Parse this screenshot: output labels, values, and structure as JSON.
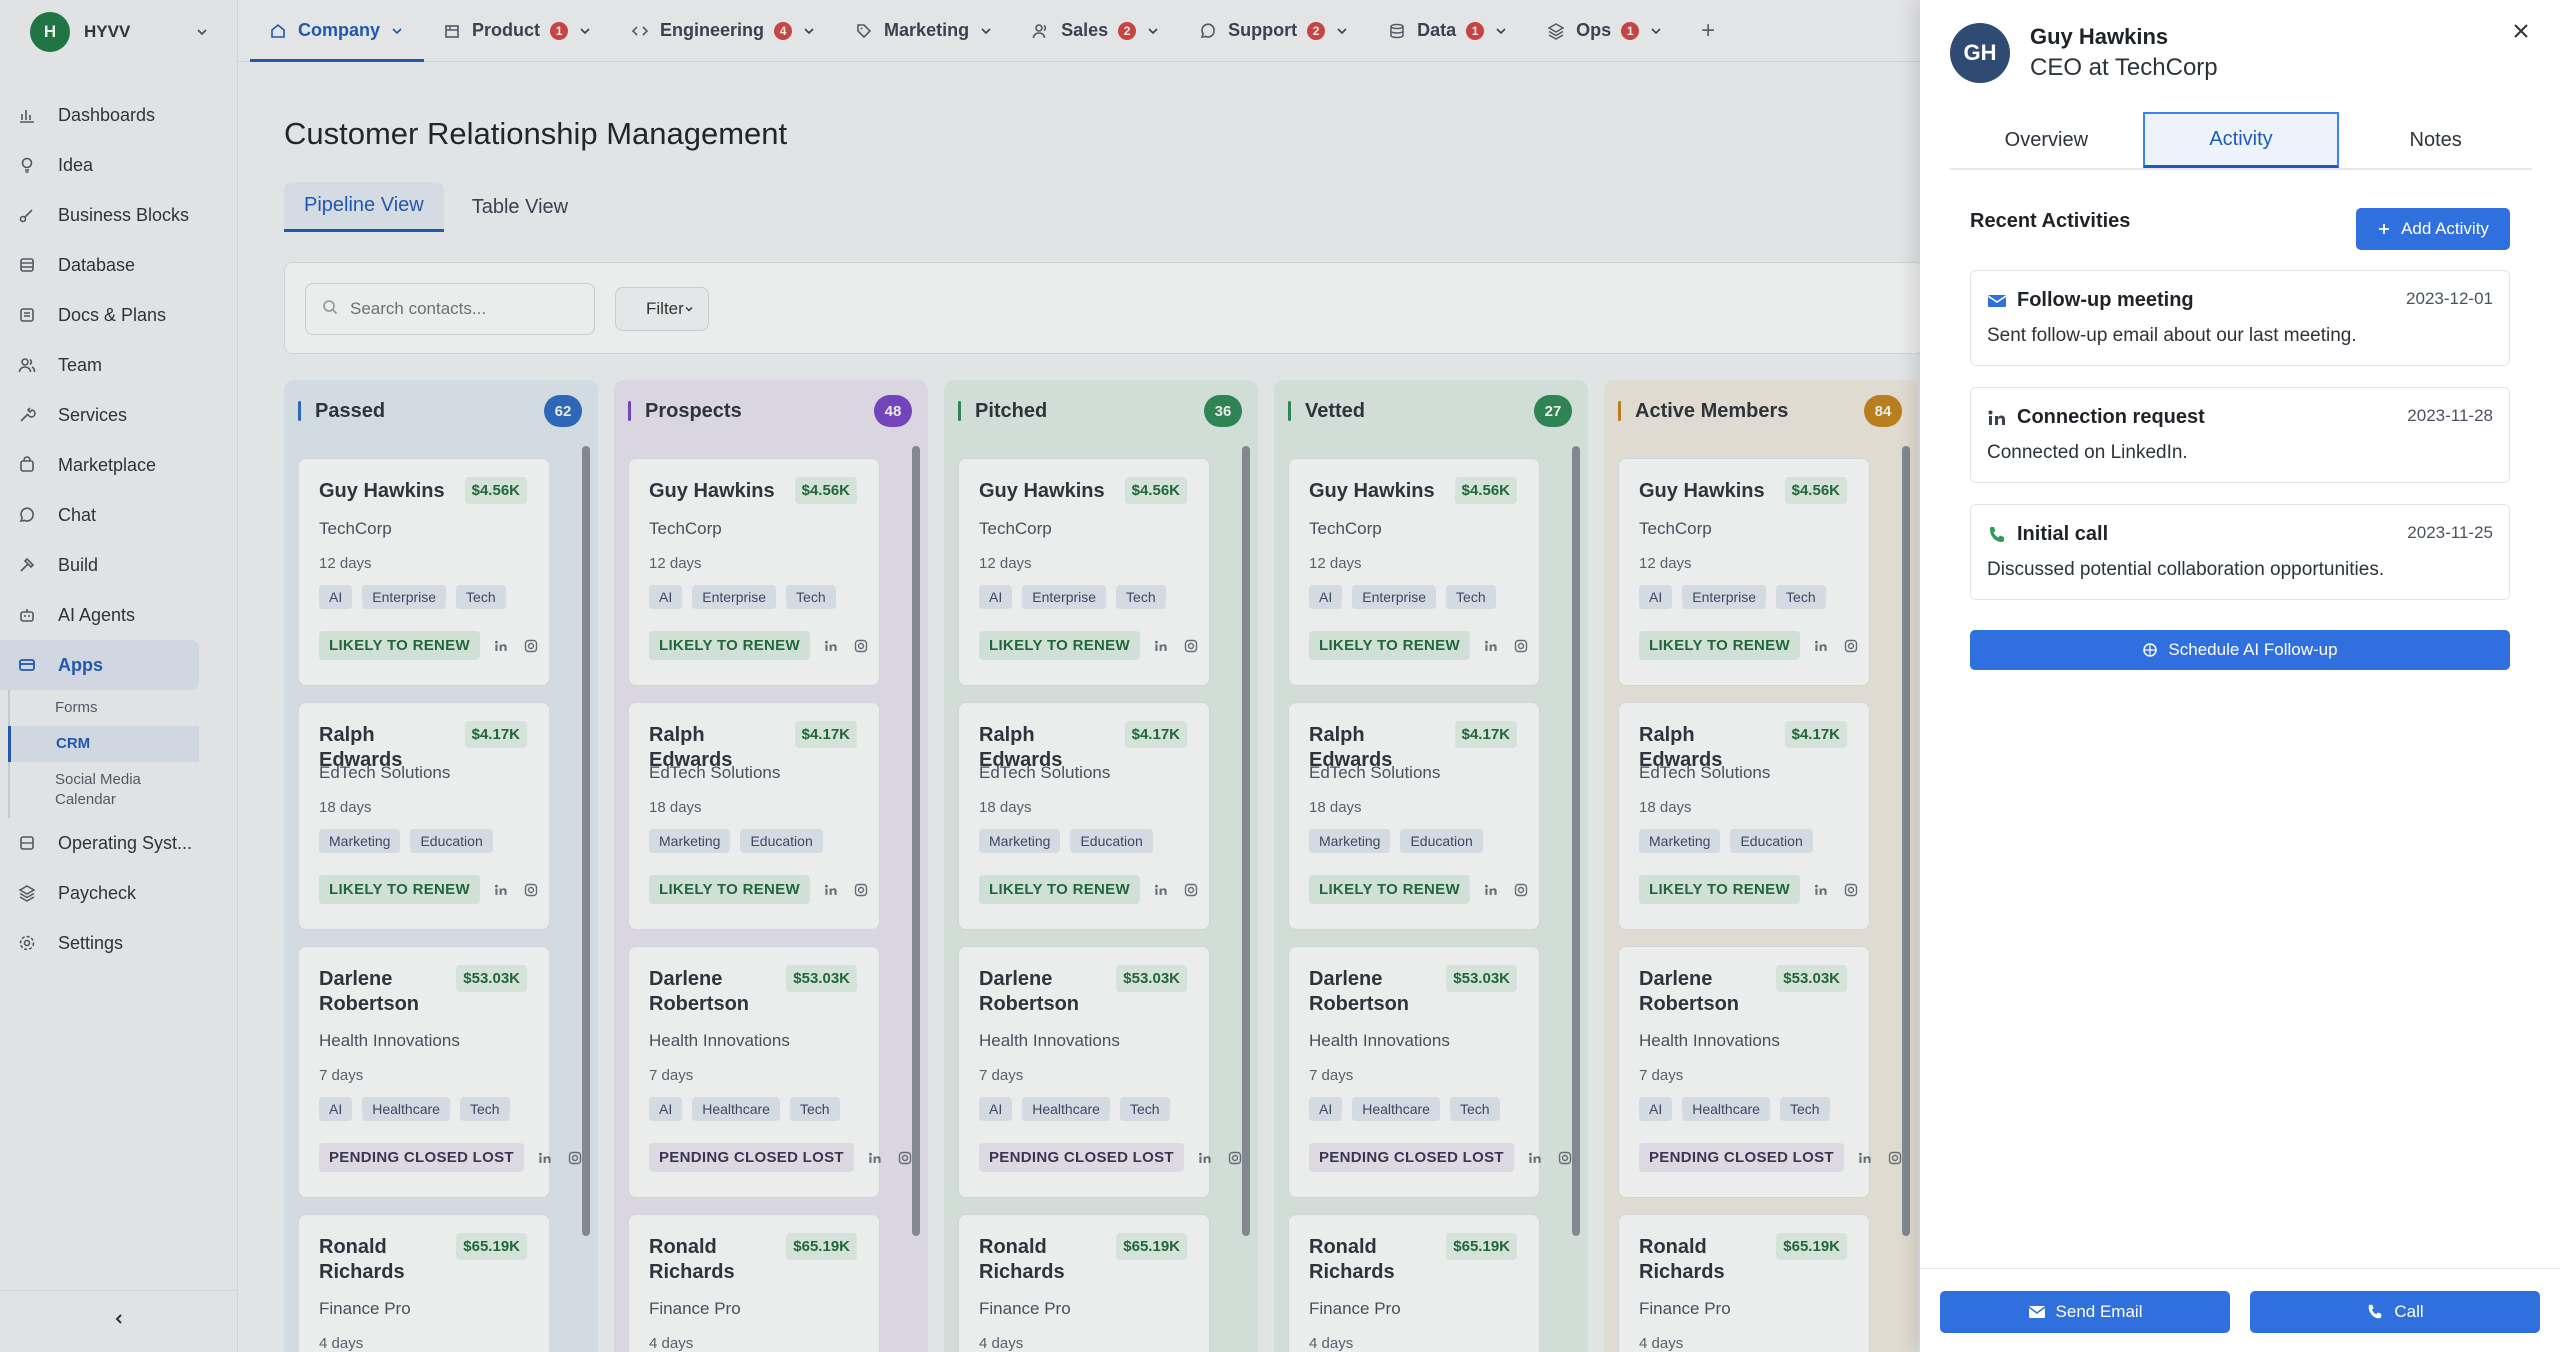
{
  "workspace": {
    "initial": "H",
    "name": "HYVV"
  },
  "sidebar": {
    "items": [
      {
        "label": "Dashboards",
        "icon": "bar-chart-icon"
      },
      {
        "label": "Idea",
        "icon": "lightbulb-icon"
      },
      {
        "label": "Business Blocks",
        "icon": "blocks-icon"
      },
      {
        "label": "Database",
        "icon": "database-icon"
      },
      {
        "label": "Docs & Plans",
        "icon": "docs-icon"
      },
      {
        "label": "Team",
        "icon": "team-icon"
      },
      {
        "label": "Services",
        "icon": "wrench-icon"
      },
      {
        "label": "Marketplace",
        "icon": "store-icon"
      },
      {
        "label": "Chat",
        "icon": "chat-icon"
      },
      {
        "label": "Build",
        "icon": "hammer-icon"
      },
      {
        "label": "AI Agents",
        "icon": "robot-icon"
      },
      {
        "label": "Apps",
        "icon": "apps-icon"
      }
    ],
    "sub_items": [
      {
        "label": "Forms"
      },
      {
        "label": "CRM"
      },
      {
        "label": "Social Media Calendar"
      }
    ],
    "bottom_items": [
      {
        "label": "Operating Syst...",
        "icon": "layers-icon"
      },
      {
        "label": "Paycheck",
        "icon": "layers-icon"
      },
      {
        "label": "Settings",
        "icon": "gear-icon"
      }
    ]
  },
  "topbar": {
    "tabs": [
      {
        "label": "Company",
        "badge": null,
        "icon": "home-icon"
      },
      {
        "label": "Product",
        "badge": "1",
        "icon": "box-icon"
      },
      {
        "label": "Engineering",
        "badge": "4",
        "icon": "code-icon"
      },
      {
        "label": "Marketing",
        "badge": null,
        "icon": "tag-icon"
      },
      {
        "label": "Sales",
        "badge": "2",
        "icon": "people-icon"
      },
      {
        "label": "Support",
        "badge": "2",
        "icon": "chat-icon"
      },
      {
        "label": "Data",
        "badge": "1",
        "icon": "database-icon"
      },
      {
        "label": "Ops",
        "badge": "1",
        "icon": "stack-icon"
      }
    ],
    "add_label": "+"
  },
  "main": {
    "title": "Customer Relationship Management",
    "view_tabs": [
      {
        "label": "Pipeline View"
      },
      {
        "label": "Table View"
      }
    ],
    "search_placeholder": "Search contacts...",
    "filter_label": "Filter"
  },
  "board": {
    "columns": [
      {
        "name": "Passed",
        "count": "62",
        "color": "#2d6bc4",
        "bg": "#e4ebf4"
      },
      {
        "name": "Prospects",
        "count": "48",
        "color": "#7b45c9",
        "bg": "#ebe6f3"
      },
      {
        "name": "Pitched",
        "count": "36",
        "color": "#2e8b57",
        "bg": "#e3efe8"
      },
      {
        "name": "Vetted",
        "count": "27",
        "color": "#2e8b57",
        "bg": "#e3efe8"
      },
      {
        "name": "Active Members",
        "count": "84",
        "color": "#c8861a",
        "bg": "#f3ece0"
      }
    ],
    "cards": [
      {
        "name": "Guy Hawkins",
        "amount": "$4.56K",
        "company": "TechCorp",
        "days": "12 days",
        "tags": [
          "AI",
          "Enterprise",
          "Tech"
        ],
        "status": "LIKELY TO RENEW"
      },
      {
        "name": "Ralph Edwards",
        "amount": "$4.17K",
        "company": "EdTech Solutions",
        "days": "18 days",
        "tags": [
          "Marketing",
          "Education"
        ],
        "status": "LIKELY TO RENEW"
      },
      {
        "name": "Darlene Robertson",
        "amount": "$53.03K",
        "company": "Health Innovations",
        "days": "7 days",
        "tags": [
          "AI",
          "Healthcare",
          "Tech"
        ],
        "status": "PENDING CLOSED LOST"
      },
      {
        "name": "Ronald Richards",
        "amount": "$65.19K",
        "company": "Finance Pro",
        "days": "4 days",
        "tags": [],
        "status": ""
      }
    ]
  },
  "panel": {
    "avatar": "GH",
    "name": "Guy Hawkins",
    "role": "CEO at TechCorp",
    "tabs": [
      {
        "label": "Overview"
      },
      {
        "label": "Activity"
      },
      {
        "label": "Notes"
      }
    ],
    "section_title": "Recent Activities",
    "add_activity": "Add Activity",
    "activities": [
      {
        "title": "Follow-up meeting",
        "date": "2023-12-01",
        "desc": "Sent follow-up email about our last meeting.",
        "icon": "mail-icon"
      },
      {
        "title": "Connection request",
        "date": "2023-11-28",
        "desc": "Connected on LinkedIn.",
        "icon": "linkedin-icon"
      },
      {
        "title": "Initial call",
        "date": "2023-11-25",
        "desc": "Discussed potential collaboration opportunities.",
        "icon": "phone-icon"
      }
    ],
    "schedule": "Schedule AI Follow-up",
    "send_email": "Send Email",
    "call": "Call"
  }
}
